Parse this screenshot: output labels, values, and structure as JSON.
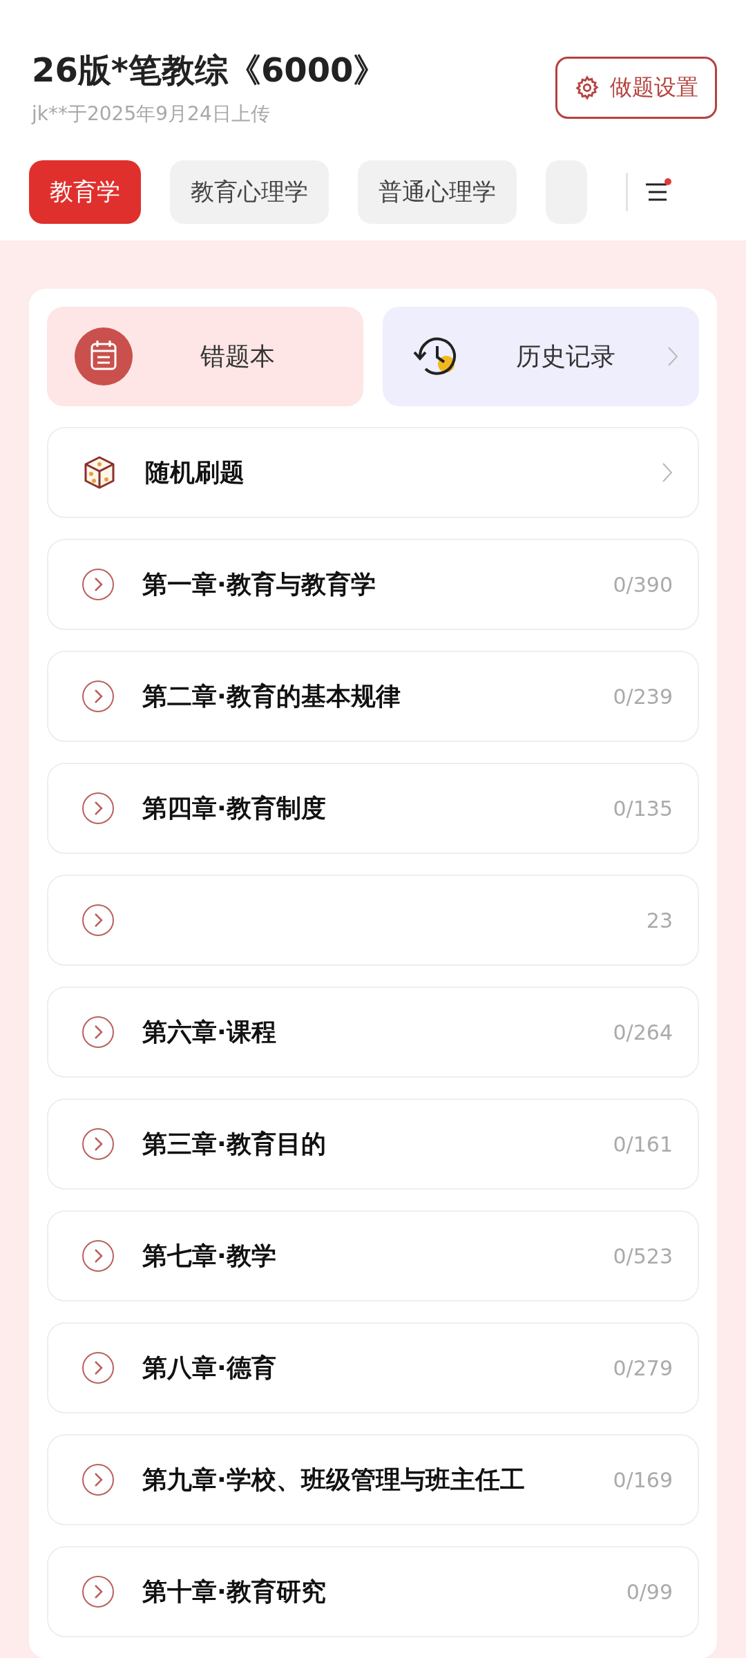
{
  "header": {
    "title": "26版*笔教综《6000》",
    "subtitle": "jk**于2025年9月24日上传",
    "settings_button": "做题设置"
  },
  "tabs": [
    {
      "label": "教育学",
      "selected": true
    },
    {
      "label": "教育心理学",
      "selected": false
    },
    {
      "label": "普通心理学",
      "selected": false
    },
    {
      "selected": false
    }
  ],
  "menu": {
    "has_notification": true
  },
  "quick_actions": [
    {
      "kind": "wrongbook",
      "label": "错题本",
      "chevron": false
    },
    {
      "kind": "history",
      "label": "历史记录",
      "chevron": true
    }
  ],
  "random": {
    "label": "随机刷题"
  },
  "chapters": [
    {
      "title": "第一章·教育与教育学",
      "count": "0/390"
    },
    {
      "title": "第二章·教育的基本规律",
      "count": "0/239"
    },
    {
      "title": "第四章·教育制度",
      "count": "0/135"
    },
    {
      "count": "23"
    },
    {
      "title": "第六章·课程",
      "count": "0/264"
    },
    {
      "title": "第三章·教育目的",
      "count": "0/161"
    },
    {
      "title": "第七章·教学",
      "count": "0/523"
    },
    {
      "title": "第八章·德育",
      "count": "0/279"
    },
    {
      "title": "第九章·学校、班级管理与班主任工",
      "count": "0/169"
    },
    {
      "title": "第十章·教育研究",
      "count": "0/99"
    }
  ]
}
